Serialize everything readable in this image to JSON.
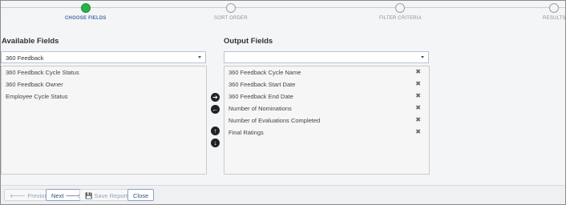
{
  "stepper": {
    "steps": [
      {
        "label": "CHOOSE FIELDS",
        "active": true
      },
      {
        "label": "SORT ORDER",
        "active": false
      },
      {
        "label": "FILTER CRITERIA",
        "active": false
      },
      {
        "label": "RESULTS",
        "active": false
      }
    ]
  },
  "available": {
    "heading": "Available Fields",
    "selected_value": "360 Feedback",
    "items": [
      "360 Feedback Cycle Status",
      "360 Feedback Owner",
      "Employee Cycle Status"
    ]
  },
  "output": {
    "heading": "Output Fields",
    "selected_value": "",
    "items": [
      "360 Feedback Cycle Name",
      "360 Feedback Start Date",
      "360 Feedback End Date",
      "Number of Nominations",
      "Number of Evaluations Completed",
      "Final Ratings"
    ],
    "remove_symbol": "✖"
  },
  "controls": {
    "add_symbol": "➔",
    "remove_symbol": "←",
    "up_symbol": "↑",
    "down_symbol": "↓"
  },
  "footer": {
    "previous": "🡐 Previous",
    "next": "Next 🡒",
    "save": "💾 Save Report",
    "close": "Close"
  },
  "colors": {
    "active_step": "#27b24a",
    "accent": "#2f4f7f"
  }
}
